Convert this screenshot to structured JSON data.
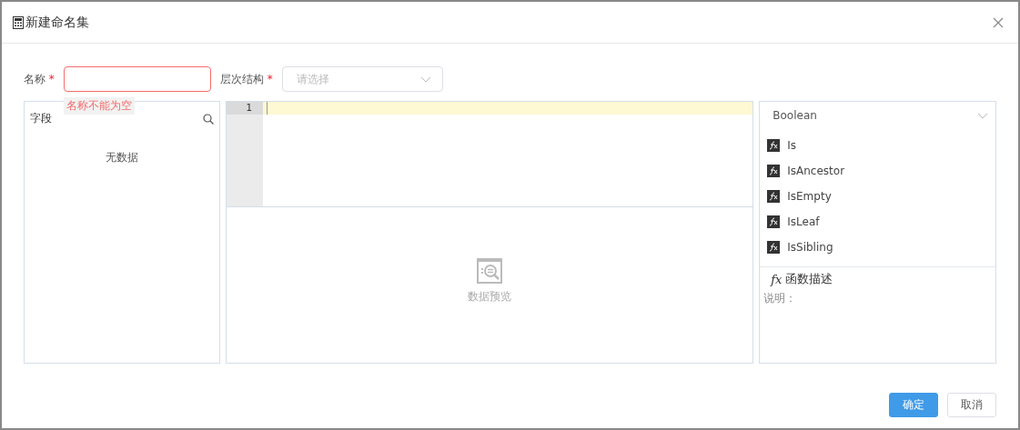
{
  "dialog": {
    "title": "新建命名集"
  },
  "form": {
    "name": {
      "label": "名称",
      "required_mark": "*",
      "invalid": true,
      "error": "名称不能为空"
    },
    "hierarchy": {
      "label": "层次结构",
      "required_mark": "*",
      "placeholder": "请选择"
    }
  },
  "fields_panel": {
    "title": "字段",
    "empty_text": "无数据"
  },
  "editor": {
    "line_numbers": [
      "1"
    ],
    "preview_text": "数据预览"
  },
  "functions_panel": {
    "category": "Boolean",
    "items": [
      "Is",
      "IsAncestor",
      "IsEmpty",
      "IsLeaf",
      "IsSibling"
    ],
    "description": {
      "symbol": "fx",
      "title": "函数描述",
      "label": "说明："
    }
  },
  "buttons": [
    {
      "label": "确定",
      "kind": "primary"
    },
    {
      "label": "取消",
      "kind": "default"
    }
  ]
}
